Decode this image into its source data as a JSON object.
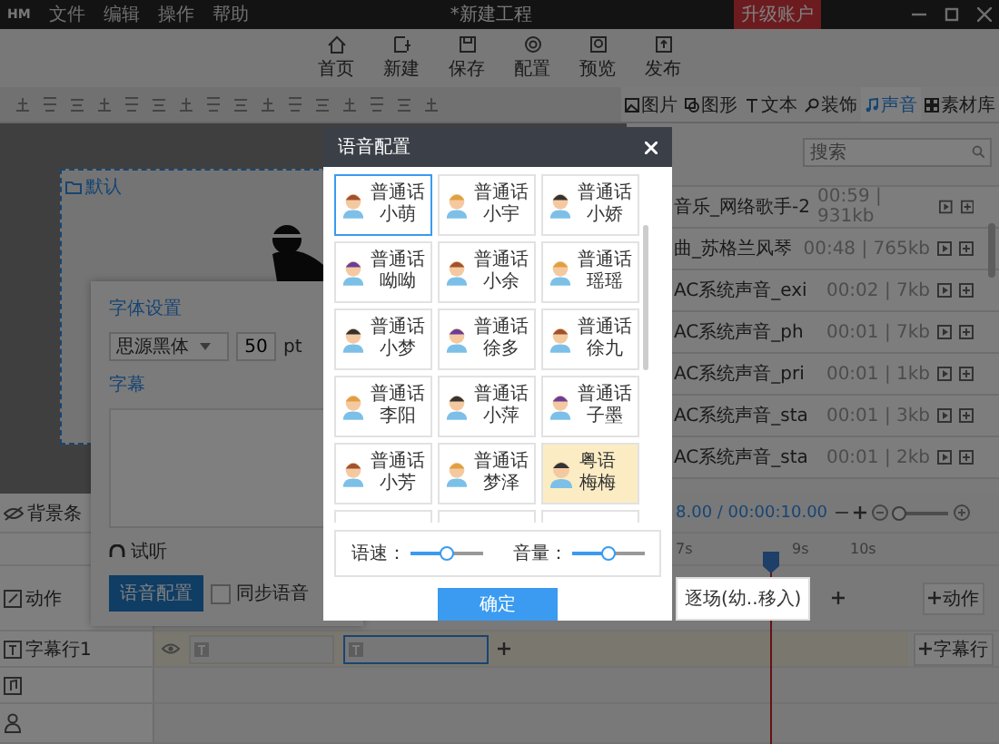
{
  "title_bar": {
    "logo": "HM",
    "menu": [
      {
        "label": "文件"
      },
      {
        "label": "编辑"
      },
      {
        "label": "操作"
      },
      {
        "label": "帮助"
      }
    ],
    "title": "*新建工程",
    "upgrade_button": "升级账户"
  },
  "toolbar": [
    {
      "kind": "home",
      "label": "首页"
    },
    {
      "kind": "new",
      "label": "新建"
    },
    {
      "kind": "save",
      "label": "保存"
    },
    {
      "kind": "config",
      "label": "配置"
    },
    {
      "kind": "preview",
      "label": "预览"
    },
    {
      "kind": "publish",
      "label": "发布"
    }
  ],
  "panel_tabs": [
    {
      "kind": "picture",
      "label": "图片",
      "selected": false
    },
    {
      "kind": "shape",
      "label": "图形",
      "selected": false
    },
    {
      "kind": "text",
      "label": "文本",
      "selected": false
    },
    {
      "kind": "decoration",
      "label": "装饰",
      "selected": false
    },
    {
      "kind": "sound",
      "label": "声音",
      "selected": true
    },
    {
      "kind": "library",
      "label": "素材库",
      "selected": false
    }
  ],
  "canvas": {
    "scene_label": "默认"
  },
  "font_panel": {
    "title": "字体设置",
    "font": "思源黑体",
    "size": "50",
    "unit": "pt",
    "caption_label": "字幕",
    "preview_label": "试听",
    "voice_button": "语音配置",
    "sync_voice": {
      "label": "同步语音",
      "checked": false
    }
  },
  "sound_library": {
    "search": {
      "placeholder": "搜索"
    },
    "items": [
      {
        "name": "音乐_网络歌手-2",
        "info": "00:59 | 931kb"
      },
      {
        "name": "曲_苏格兰风琴",
        "info": "00:48 | 765kb"
      },
      {
        "name": "AC系统声音_exi",
        "info": "00:02 | 7kb"
      },
      {
        "name": "AC系统声音_ph",
        "info": "00:01 | 7kb"
      },
      {
        "name": "AC系统声音_pri",
        "info": "00:01 | 1kb"
      },
      {
        "name": "AC系统声音_sta",
        "info": "00:01 | 3kb"
      },
      {
        "name": "AC系统声音_sta",
        "info": "00:01 | 2kb"
      }
    ]
  },
  "timeline": {
    "time": "8.00 / 00:00:10.00",
    "zoom": {
      "level": 0.1
    },
    "ruler": [
      "7s",
      "9s",
      "10s"
    ],
    "tracks": [
      {
        "kind": "background",
        "label": "背景条"
      },
      {
        "kind": "action",
        "label": "动作",
        "clip": "逐场(幼..移入)",
        "add_button": "动作"
      },
      {
        "kind": "caption",
        "label": "字幕行1",
        "add_button": "字幕行"
      },
      {
        "kind": "audio"
      },
      {
        "kind": "person"
      }
    ]
  },
  "voice_dialog": {
    "title": "语音配置",
    "voices": [
      {
        "language": "普通话",
        "name": "小萌",
        "selected": true,
        "highlighted": false
      },
      {
        "language": "普通话",
        "name": "小宇",
        "selected": false,
        "highlighted": false
      },
      {
        "language": "普通话",
        "name": "小娇",
        "selected": false,
        "highlighted": false
      },
      {
        "language": "普通话",
        "name": "呦呦",
        "selected": false,
        "highlighted": false
      },
      {
        "language": "普通话",
        "name": "小余",
        "selected": false,
        "highlighted": false
      },
      {
        "language": "普通话",
        "name": "瑶瑶",
        "selected": false,
        "highlighted": false
      },
      {
        "language": "普通话",
        "name": "小梦",
        "selected": false,
        "highlighted": false
      },
      {
        "language": "普通话",
        "name": "徐多",
        "selected": false,
        "highlighted": false
      },
      {
        "language": "普通话",
        "name": "徐九",
        "selected": false,
        "highlighted": false
      },
      {
        "language": "普通话",
        "name": "李阳",
        "selected": false,
        "highlighted": false
      },
      {
        "language": "普通话",
        "name": "小萍",
        "selected": false,
        "highlighted": false
      },
      {
        "language": "普通话",
        "name": "子墨",
        "selected": false,
        "highlighted": false
      },
      {
        "language": "普通话",
        "name": "小芳",
        "selected": false,
        "highlighted": false
      },
      {
        "language": "普通话",
        "name": "梦泽",
        "selected": false,
        "highlighted": false
      },
      {
        "language": "粤语",
        "name": "梅梅",
        "selected": false,
        "highlighted": true
      }
    ],
    "speed": {
      "label": "语速：",
      "level": 0.5
    },
    "volume": {
      "label": "音量：",
      "level": 0.5
    },
    "confirm_button": "确定"
  }
}
